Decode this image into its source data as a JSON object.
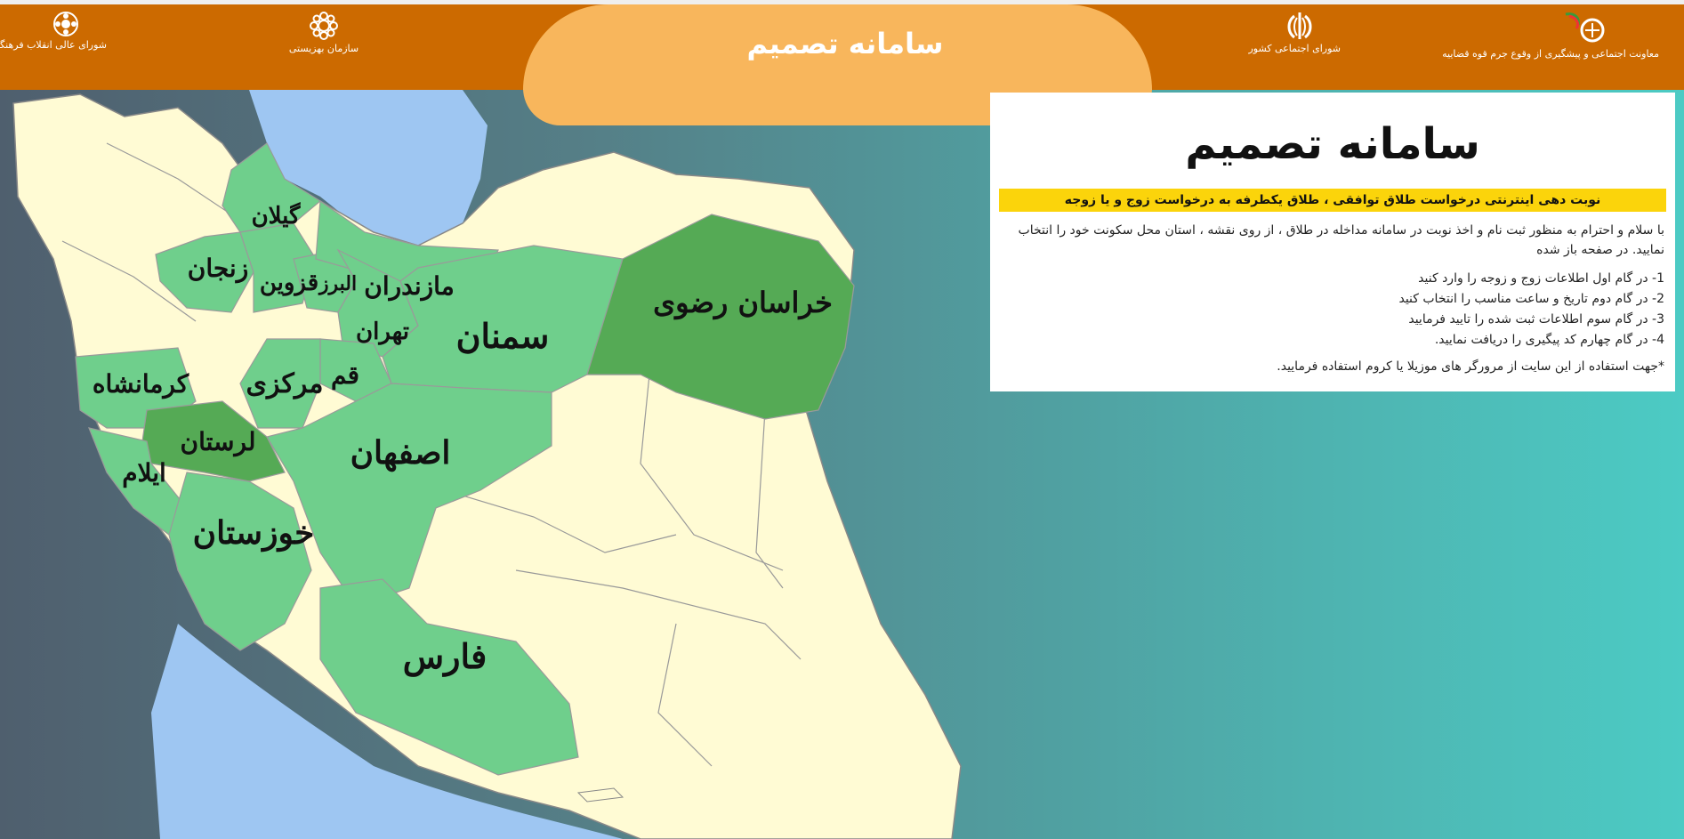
{
  "header": {
    "title": "سامانه تصمیم",
    "logos": [
      {
        "icon": "emblem-flower-icon",
        "caption": "شورای عالی انقلاب فرهنگی"
      },
      {
        "icon": "emblem-flower-icon",
        "caption": "سازمان بهزیستی"
      },
      {
        "icon": "iran-emblem-icon",
        "caption": "شورای اجتماعی کشور"
      },
      {
        "icon": "judiciary-emblem-icon",
        "caption": "معاونت اجتماعی و پیشگیری از وقوع جرم قوه قضاییه"
      }
    ]
  },
  "map": {
    "provinces": [
      {
        "name": "گیلان",
        "status": "active"
      },
      {
        "name": "زنجان",
        "status": "active"
      },
      {
        "name": "قزوین",
        "status": "active"
      },
      {
        "name": "البرز",
        "status": "active"
      },
      {
        "name": "مازندران",
        "status": "active"
      },
      {
        "name": "تهران",
        "status": "active"
      },
      {
        "name": "قم",
        "status": "active"
      },
      {
        "name": "سمنان",
        "status": "active"
      },
      {
        "name": "خراسان رضوی",
        "status": "highlight"
      },
      {
        "name": "مرکزی",
        "status": "active"
      },
      {
        "name": "کرمانشاه",
        "status": "active"
      },
      {
        "name": "لرستان",
        "status": "highlight"
      },
      {
        "name": "ایلام",
        "status": "active"
      },
      {
        "name": "اصفهان",
        "status": "active"
      },
      {
        "name": "خوزستان",
        "status": "active"
      },
      {
        "name": "فارس",
        "status": "active"
      }
    ],
    "colors": {
      "active": "#6fcf8c",
      "highlight": "#55aa55",
      "inactive": "#fffbd4",
      "water": "#9ec6f2"
    }
  },
  "panel": {
    "title": "سامانه تصمیم",
    "banner": "نوبت دهی اینترنتی درخواست طلاق توافقی ، طلاق یکطرفه به درخواست زوج و یا زوجه",
    "intro": "با سلام و احترام به منظور ثبت نام و اخذ نوبت در سامانه مداخله در طلاق ، از روی نقشه ، استان محل سکونت خود را انتخاب نمایید. در صفحه باز شده",
    "steps": [
      "1- در گام اول اطلاعات زوج و زوجه را وارد کنید",
      "2- در گام دوم تاریخ و ساعت مناسب را انتخاب کنید",
      "3- در گام سوم اطلاعات ثبت شده را تایید فرمایید",
      "4- در گام چهارم کد پیگیری را دریافت نمایید."
    ],
    "note": "*جهت استفاده از این سایت از مرورگر های موزیلا یا کروم استفاده فرمایید."
  }
}
